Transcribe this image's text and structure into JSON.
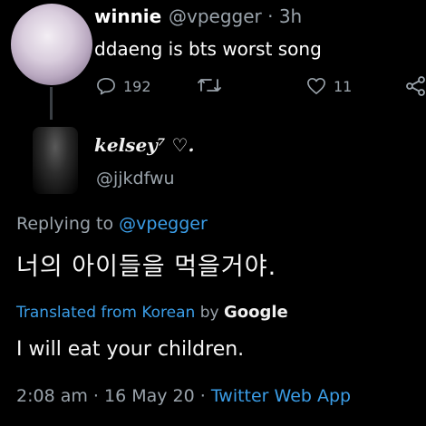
{
  "original_tweet": {
    "display_name": "winnie",
    "handle_time": "@vpegger · 3h",
    "text": "ddaeng is bts worst song",
    "reply_count": "192",
    "retweet_count": "",
    "like_count": "11",
    "icons": [
      "reply-icon",
      "retweet-icon",
      "heart-icon",
      "share-icon"
    ]
  },
  "reply_tweet": {
    "display_name": "kelsey⁷ ♡.",
    "handle": "@jjkdfwu",
    "replying_prefix": "Replying to ",
    "replying_mention": "@vpegger",
    "text": "너의 아이들을 먹을거야.",
    "translated_prefix": "Translated from Korean",
    "translated_by": " by ",
    "translated_service": "Google",
    "translation": "I will eat your children.",
    "timestamp": "2:08 am · 16 May 20 · ",
    "source": "Twitter Web App"
  },
  "colors": {
    "background": "#000000",
    "accent": "#3b9ee8",
    "secondary_text": "#9aa3ab"
  }
}
